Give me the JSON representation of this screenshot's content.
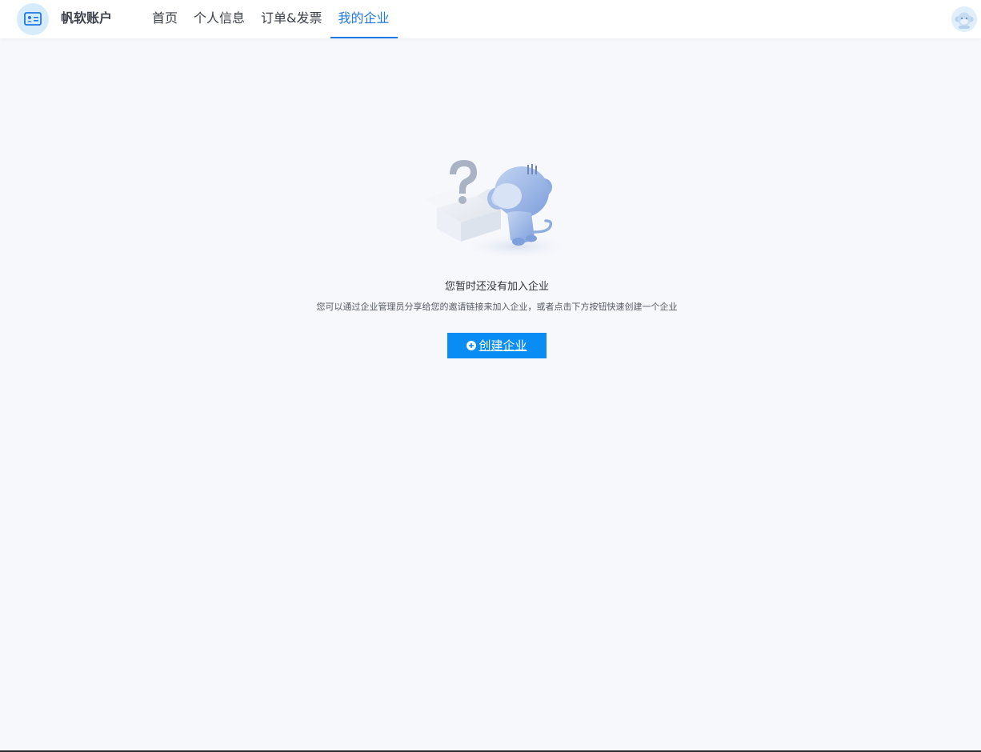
{
  "header": {
    "brand": "帆软账户",
    "nav": [
      {
        "label": "首页",
        "active": false
      },
      {
        "label": "个人信息",
        "active": false
      },
      {
        "label": "订单&发票",
        "active": false
      },
      {
        "label": "我的企业",
        "active": true
      }
    ],
    "logo_icon": "id-card-icon",
    "avatar_icon": "monkey-avatar-icon"
  },
  "empty_state": {
    "illustration_icon": "monkey-question-box-illustration",
    "title": "您暂时还没有加入企业",
    "description": "您可以通过企业管理员分享给您的邀请链接来加入企业，或者点击下方按钮快速创建一个企业",
    "button_label": "创建企业",
    "button_icon": "plus-circle-icon"
  },
  "colors": {
    "accent": "#1e78e6",
    "button": "#0a8cf5",
    "background": "#f7f8fc"
  }
}
